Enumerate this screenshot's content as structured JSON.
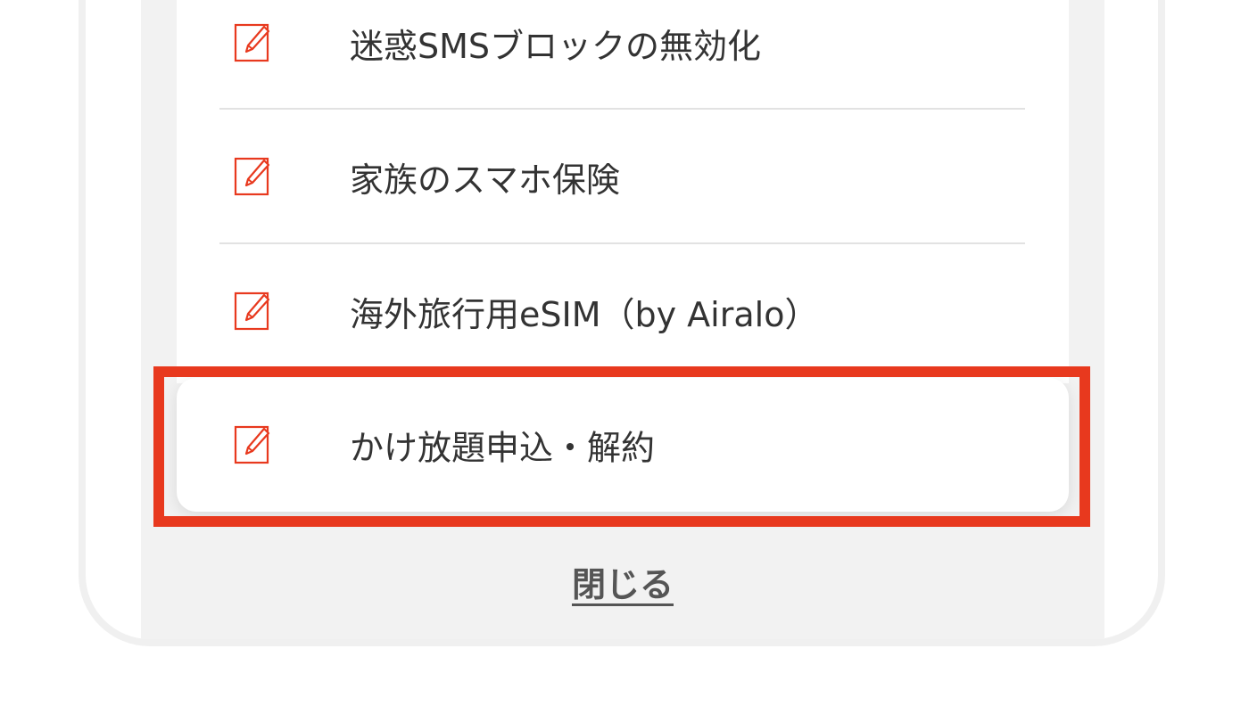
{
  "menu": {
    "items": [
      {
        "label": "迷惑SMSブロックの無効化",
        "icon": "edit-form-icon"
      },
      {
        "label": "家族のスマホ保険",
        "icon": "edit-form-icon"
      },
      {
        "label": "海外旅行用eSIM（by Airalo）",
        "icon": "edit-form-icon"
      }
    ],
    "highlighted_item": {
      "label": "かけ放題申込・解約",
      "icon": "edit-form-icon"
    }
  },
  "close_label": "閉じる",
  "colors": {
    "accent": "#e8391e",
    "icon": "#e8391e",
    "text": "#333333",
    "background": "#f2f2f2"
  }
}
